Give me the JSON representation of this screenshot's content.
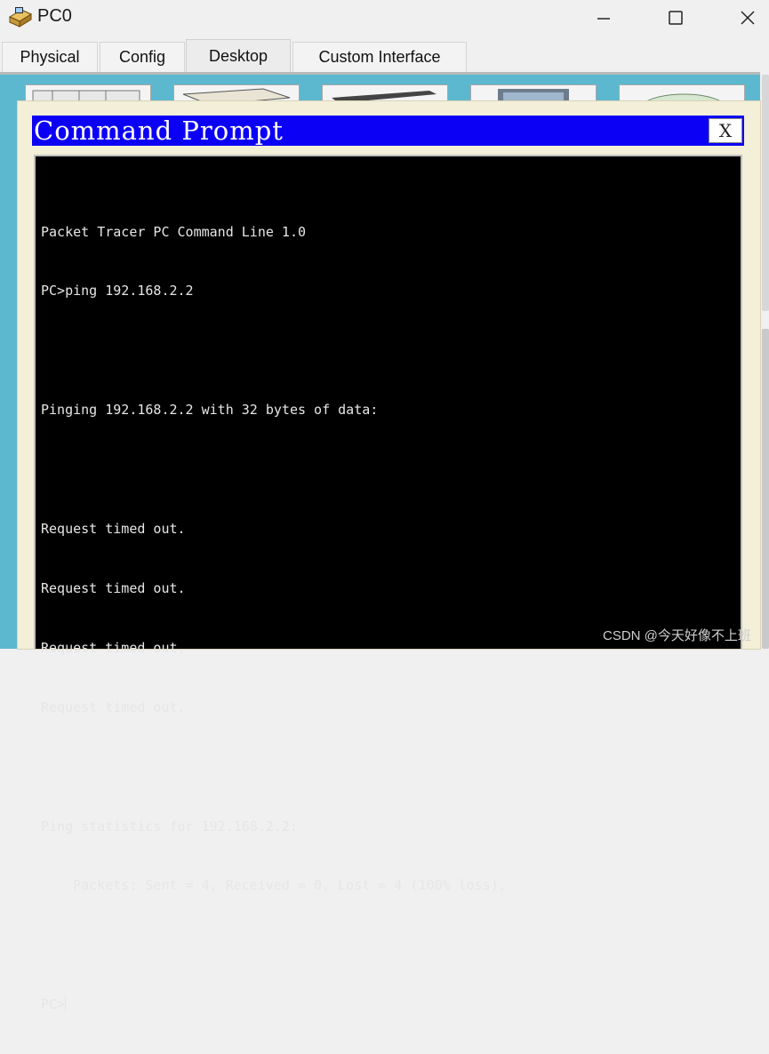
{
  "window": {
    "title": "PC0",
    "icon": "packet-tracer-pc-icon",
    "controls": [
      "minimize-icon",
      "maximize-icon",
      "close-icon"
    ]
  },
  "tabs": [
    {
      "label": "Physical",
      "active": false
    },
    {
      "label": "Config",
      "active": false
    },
    {
      "label": "Desktop",
      "active": true
    },
    {
      "label": "Custom Interface",
      "active": false
    }
  ],
  "command_prompt": {
    "title": "Command Prompt",
    "close_label": "X",
    "lines": [
      "Packet Tracer PC Command Line 1.0",
      "PC>ping 192.168.2.2",
      "",
      "Pinging 192.168.2.2 with 32 bytes of data:",
      "",
      "Request timed out.",
      "Request timed out.",
      "Request timed out.",
      "Request timed out.",
      "",
      "Ping statistics for 192.168.2.2:",
      "    Packets: Sent = 4, Received = 0, Lost = 4 (100% loss),",
      ""
    ],
    "prompt": "PC>"
  },
  "watermark": "CSDN @今天好像不上班",
  "colors": {
    "desktop_bg": "#5cb8cf",
    "cmd_titlebar": "#0b00f5",
    "console_bg": "#000000",
    "console_text": "#e6e6e6"
  }
}
